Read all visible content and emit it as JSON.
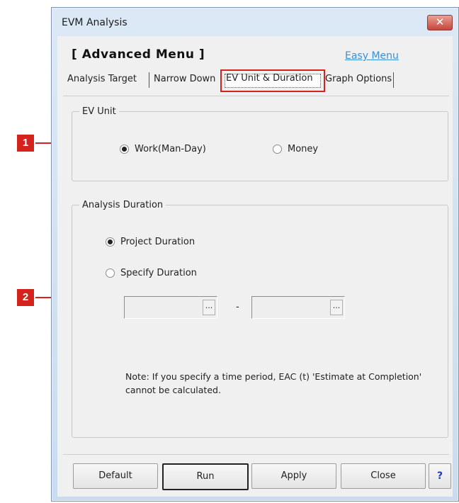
{
  "window": {
    "title": "EVM Analysis",
    "close_glyph": "✕"
  },
  "header": {
    "menu_title": "[ Advanced Menu ]",
    "easy_menu_link": "Easy Menu"
  },
  "tabs": [
    {
      "label": "Analysis Target"
    },
    {
      "label": "Narrow Down"
    },
    {
      "label": "EV Unit & Duration",
      "active": true
    },
    {
      "label": "Graph Options"
    }
  ],
  "ev_unit": {
    "legend": "EV Unit",
    "options": [
      {
        "label": "Work(Man-Day)",
        "selected": true
      },
      {
        "label": "Money",
        "selected": false
      }
    ]
  },
  "analysis_duration": {
    "legend": "Analysis Duration",
    "options": [
      {
        "label": "Project Duration",
        "selected": true
      },
      {
        "label": "Specify Duration",
        "selected": false
      }
    ],
    "start_date": {
      "value": "",
      "button": "..."
    },
    "separator": "-",
    "end_date": {
      "value": "",
      "button": "..."
    },
    "note": "Note: If you specify a time period, EAC (t) 'Estimate at Completion' cannot be calculated."
  },
  "buttons": {
    "default": "Default",
    "run": "Run",
    "apply": "Apply",
    "close": "Close",
    "help": "?"
  },
  "callouts": {
    "one": "1",
    "two": "2"
  },
  "colors": {
    "callout": "#d4221c",
    "link": "#3a8ed6"
  }
}
